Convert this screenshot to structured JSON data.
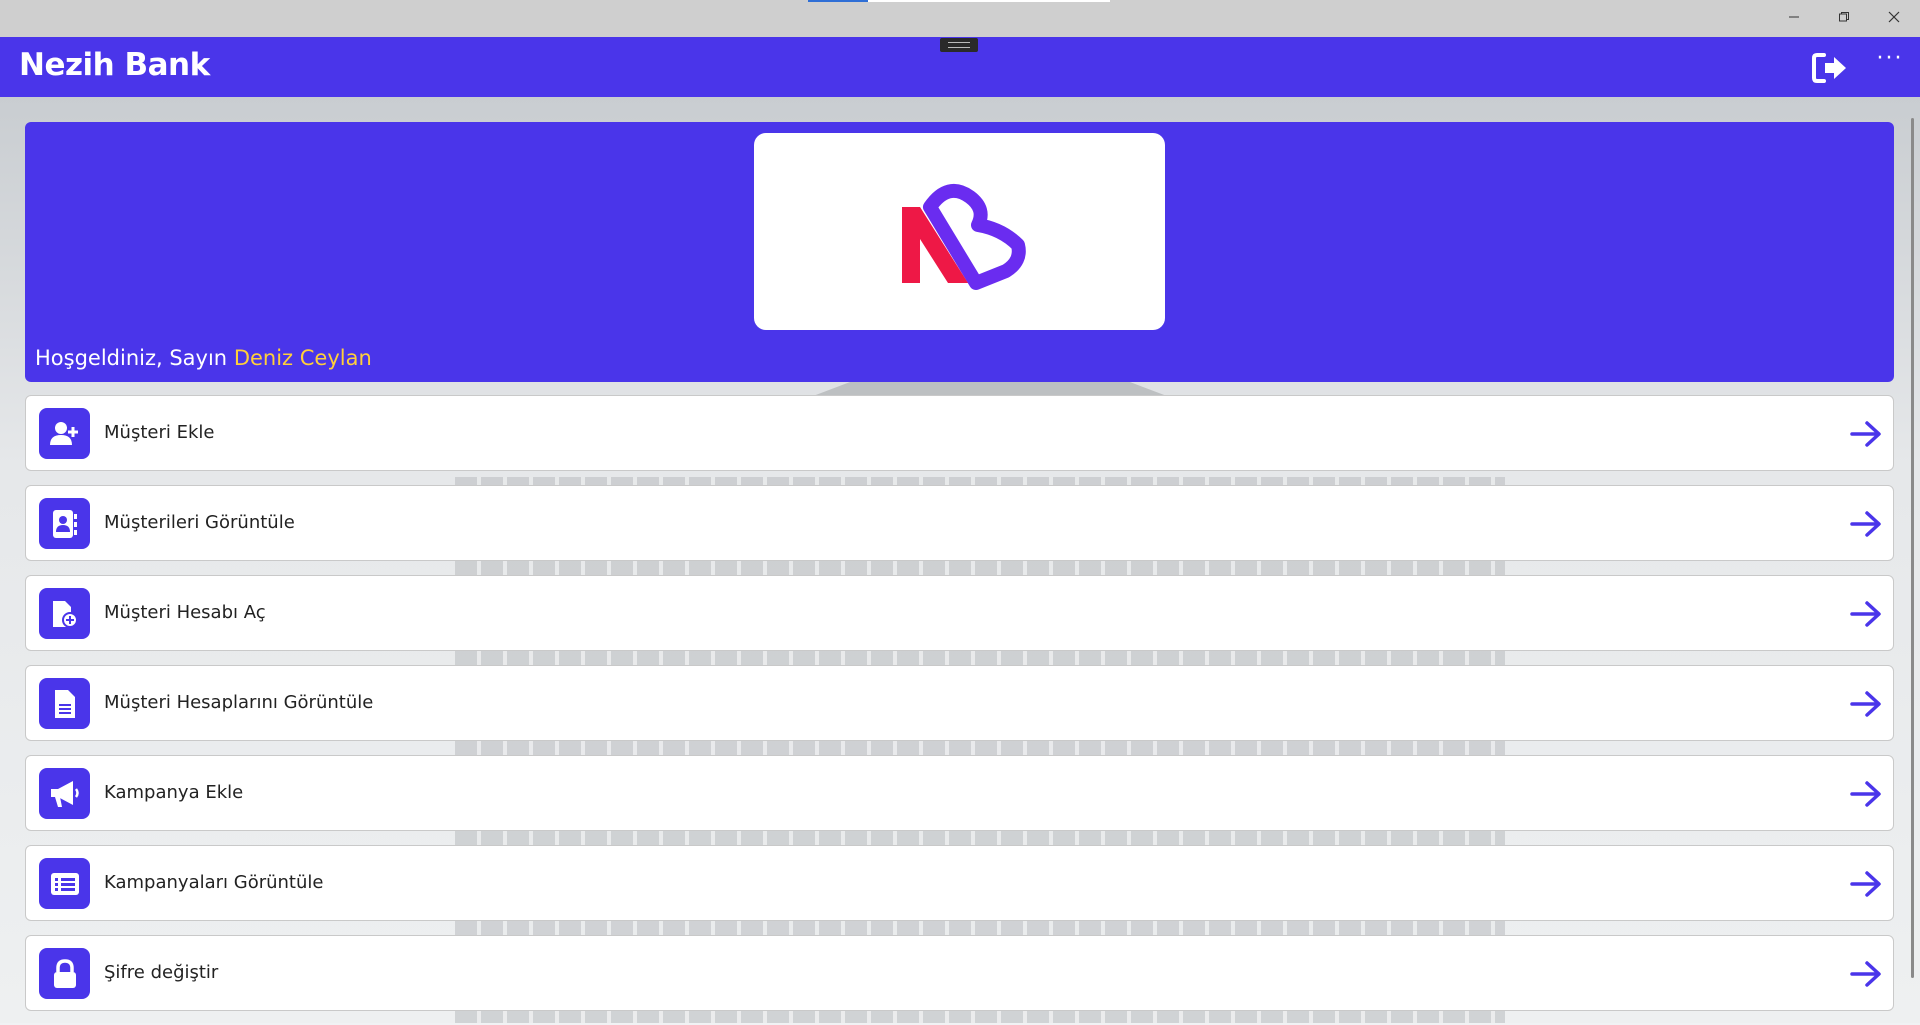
{
  "window": {
    "minimize_icon": "minimize-icon",
    "maximize_icon": "restore-icon",
    "close_icon": "close-icon"
  },
  "appbar": {
    "title": "Nezih Bank",
    "logout_icon": "logout-icon",
    "more_icon": "more-icon",
    "more_label": "···"
  },
  "hero": {
    "welcome_prefix": "Hoşgeldiniz, Sayın",
    "user_name": "Deniz Ceylan",
    "logo_text": "NB"
  },
  "menu": {
    "items": [
      {
        "label": "Müşteri Ekle",
        "icon": "user-plus-icon"
      },
      {
        "label": "Müşterileri Görüntüle",
        "icon": "contacts-book-icon"
      },
      {
        "label": "Müşteri Hesabı Aç",
        "icon": "file-add-icon"
      },
      {
        "label": "Müşteri Hesaplarını Görüntüle",
        "icon": "document-icon"
      },
      {
        "label": "Kampanya Ekle",
        "icon": "megaphone-icon"
      },
      {
        "label": "Kampanyaları Görüntüle",
        "icon": "list-icon"
      },
      {
        "label": "Şifre değiştir",
        "icon": "lock-icon"
      }
    ]
  },
  "colors": {
    "brand": "#4a35ea",
    "accent_name": "#ffcf3a",
    "logo_red": "#ee1846",
    "logo_purple": "#6a2cf0"
  }
}
